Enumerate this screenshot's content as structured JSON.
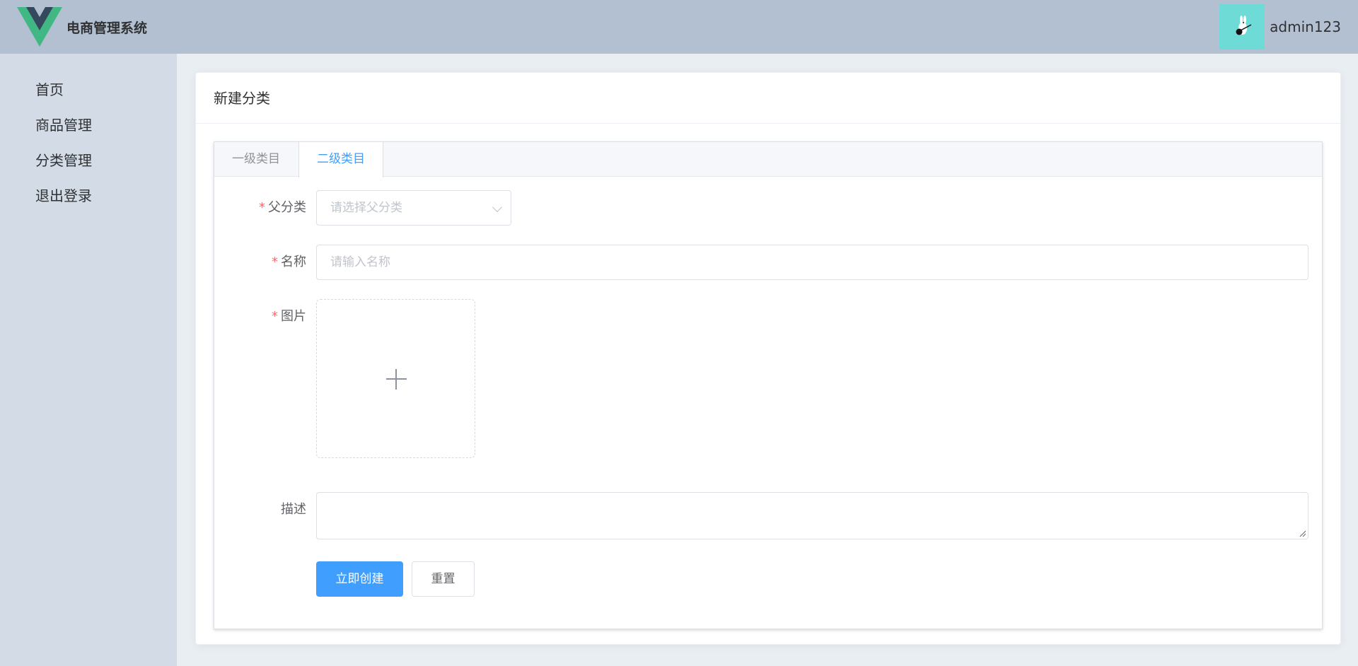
{
  "header": {
    "brand_title": "电商管理系统",
    "logo_icon": "vue-logo-icon",
    "username": "admin123",
    "avatar_icon": "avatar-icon"
  },
  "sidebar": {
    "items": [
      {
        "label": "首页"
      },
      {
        "label": "商品管理"
      },
      {
        "label": "分类管理"
      },
      {
        "label": "退出登录"
      }
    ]
  },
  "page": {
    "title": "新建分类"
  },
  "tabs": [
    {
      "label": "一级类目",
      "active": false
    },
    {
      "label": "二级类目",
      "active": true
    }
  ],
  "form": {
    "parent": {
      "required_mark": "*",
      "label": "父分类",
      "placeholder": "请选择父分类"
    },
    "name": {
      "required_mark": "*",
      "label": "名称",
      "placeholder": "请输入名称"
    },
    "image": {
      "required_mark": "*",
      "label": "图片"
    },
    "description": {
      "label": "描述",
      "value": ""
    },
    "submit_label": "立即创建",
    "reset_label": "重置"
  },
  "colors": {
    "header_bg": "#b3c0d1",
    "sidebar_bg": "#d3dce6",
    "main_bg": "#e9eef3",
    "primary": "#409eff",
    "required": "#f56c6c",
    "avatar_bg": "#6fdbd6"
  }
}
